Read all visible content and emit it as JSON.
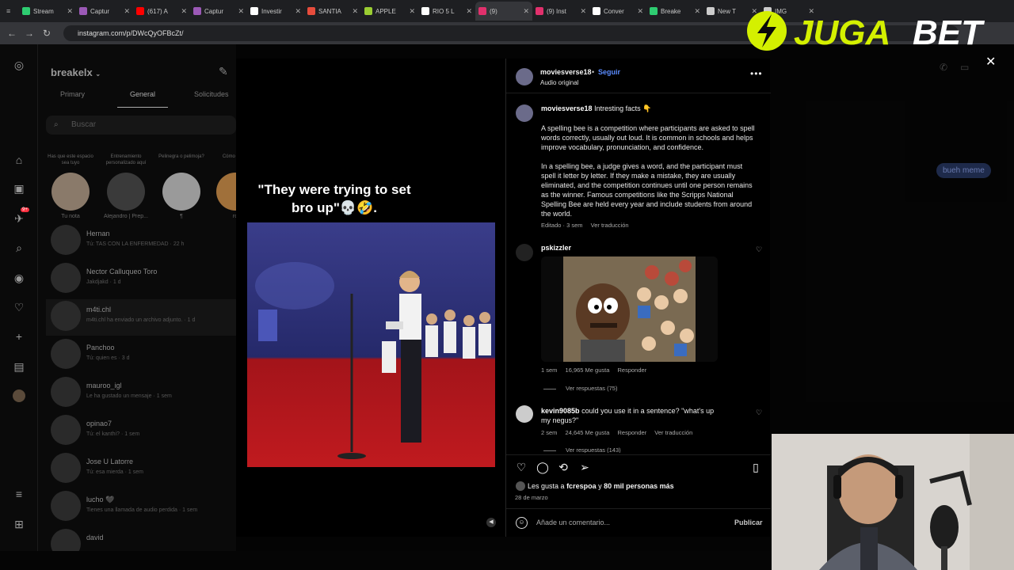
{
  "browser": {
    "tabs": [
      {
        "label": "Stream",
        "color": "#2ecc71"
      },
      {
        "label": "Captur",
        "color": "#9b59b6"
      },
      {
        "label": "(617) A",
        "color": "#ff0000"
      },
      {
        "label": "Captur",
        "color": "#9b59b6"
      },
      {
        "label": "Investir",
        "color": "#ffffff"
      },
      {
        "label": "SANTIA",
        "color": "#e74c3c"
      },
      {
        "label": "APPLE",
        "color": "#9acd32"
      },
      {
        "label": "RIO 5 L",
        "color": "#ffffff"
      },
      {
        "label": "(9)",
        "color": "#e1306c"
      },
      {
        "label": "(9) Inst",
        "color": "#e1306c"
      },
      {
        "label": "Conver",
        "color": "#ffffff"
      },
      {
        "label": "Breake",
        "color": "#2ecc71"
      },
      {
        "label": "New T",
        "color": "#cccccc"
      },
      {
        "label": "IMG",
        "color": "#cccccc"
      }
    ],
    "url": "instagram.com/p/DWcQyOFBcZt/"
  },
  "dm": {
    "username": "breakelx",
    "tabs": [
      "Primary",
      "General",
      "Solicitudes"
    ],
    "search_placeholder": "Buscar",
    "notes": [
      {
        "bubble": "Has que este espacio sea tuyo",
        "name": "Tu nota"
      },
      {
        "bubble": "Entrenamiento personalizado aquí",
        "name": "Alejandro | Prep..."
      },
      {
        "bubble": "Pelinegra o pelimoja?",
        "name": "¶"
      },
      {
        "bubble": "Cómo le fue",
        "name": "ro"
      }
    ],
    "conversations": [
      {
        "name": "Hernan",
        "msg": "Tú: TAS CON LA ENFERMEDAD · 22 h"
      },
      {
        "name": "Nector Calluqueo Toro",
        "msg": "Jakdjakd · 1 d"
      },
      {
        "name": "m4ti.chl",
        "msg": "m4ti.chl ha enviado un archivo adjunto. · 1 d"
      },
      {
        "name": "Panchoo",
        "msg": "Tú: quien es · 3 d"
      },
      {
        "name": "mauroo_igl",
        "msg": "Le ha gustado un mensaje · 1 sem"
      },
      {
        "name": "opinao7",
        "msg": "Tú: el kanthi? · 1 sem"
      },
      {
        "name": "Jose U Latorre",
        "msg": "Tú: esa mierda · 1 sem"
      },
      {
        "name": "lucho 🖤",
        "msg": "Tienes una llamada de audio perdida · 1 sem"
      },
      {
        "name": "david",
        "msg": ""
      }
    ],
    "notif_badge": "9+"
  },
  "chat": {
    "bubble": "bueh meme"
  },
  "post": {
    "overlay_caption": "\"They were trying to set bro up\"💀🤣.",
    "author": "moviesverse18",
    "follow": "Seguir",
    "dot": "•",
    "audio": "Audio original",
    "more": "•••",
    "caption_title": "Intresting facts 👇",
    "caption_p1": "A spelling bee is a competition where participants are asked to spell words correctly, usually out loud. It is common in schools and helps improve vocabulary, pronunciation, and confidence.",
    "caption_p2": "In a spelling bee, a judge gives a word, and the participant must spell it letter by letter. If they make a mistake, they are usually eliminated, and the competition continues until one person remains as the winner. Famous competitions like the Scripps National Spelling Bee are held every year and include students from around the world.",
    "caption_meta": "Editado · 3 sem",
    "translate": "Ver traducción",
    "comments": [
      {
        "user": "pskizzler",
        "text": "",
        "time": "1 sem",
        "likes": "16,965 Me gusta",
        "reply": "Responder",
        "translate": "",
        "replies": "Ver respuestas (75)"
      },
      {
        "user": "kevin9085b",
        "text": "could you use it in a sentence? \"what's up my negus?\"",
        "time": "2 sem",
        "likes": "24,645 Me gusta",
        "reply": "Responder",
        "translate": "Ver traducción",
        "replies": "Ver respuestas (143)"
      }
    ],
    "likes_prefix": "Les gusta a",
    "likes_user": "fcrespoa",
    "likes_and": "y",
    "likes_count": "80 mil personas más",
    "date": "28 de marzo",
    "comment_placeholder": "Añade un comentario...",
    "publish": "Publicar"
  },
  "brand": {
    "logo_a": "JUGA",
    "logo_b": "BET",
    "accent": "#d4f000"
  }
}
